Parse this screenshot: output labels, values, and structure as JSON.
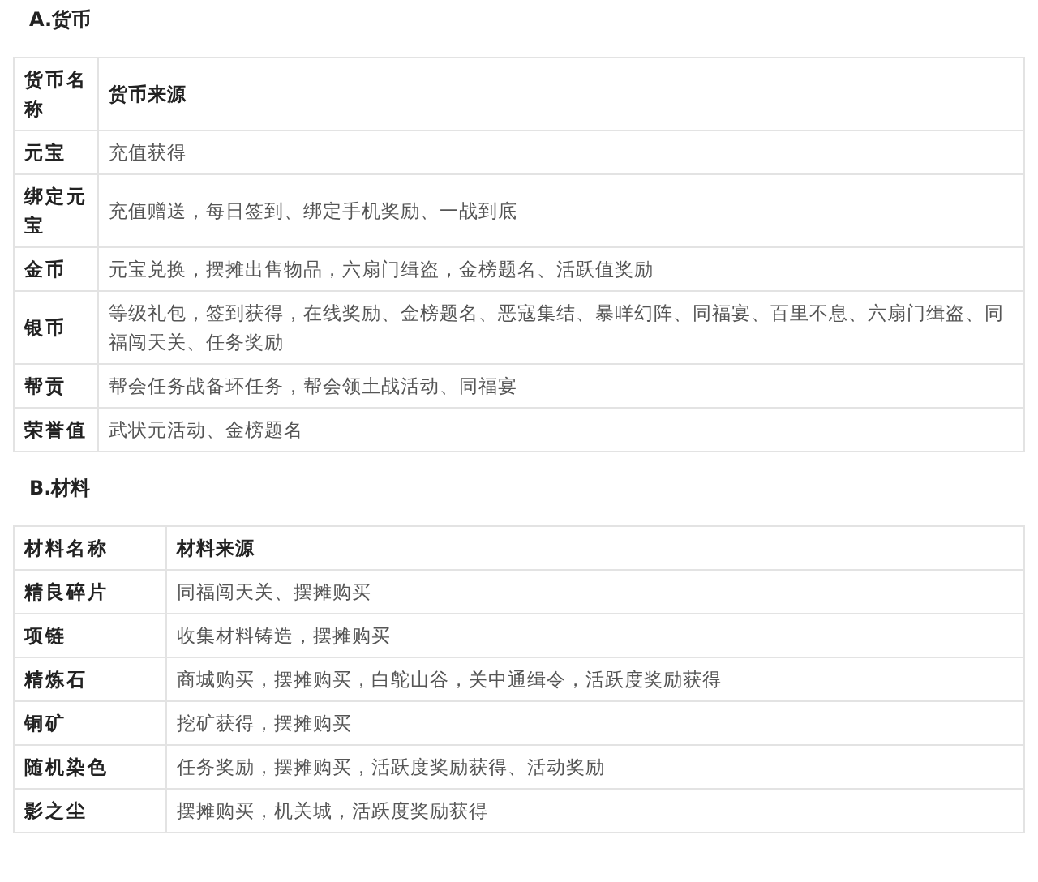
{
  "sections": [
    {
      "heading": "A.货币",
      "columns": [
        "货币名称",
        "货币来源"
      ],
      "rows": [
        [
          "元宝",
          "充值获得"
        ],
        [
          "绑定元宝",
          "充值赠送，每日签到、绑定手机奖励、一战到底"
        ],
        [
          "金币",
          "元宝兑换，摆摊出售物品，六扇门缉盗，金榜题名、活跃值奖励"
        ],
        [
          "银币",
          "等级礼包，签到获得，在线奖励、金榜题名、恶寇集结、暴咩幻阵、同福宴、百里不息、六扇门缉盗、同福闯天关、任务奖励"
        ],
        [
          "帮贡",
          "帮会任务战备环任务，帮会领土战活动、同福宴"
        ],
        [
          "荣誉值",
          "武状元活动、金榜题名"
        ]
      ]
    },
    {
      "heading": "B.材料",
      "columns": [
        "材料名称",
        "材料来源"
      ],
      "rows": [
        [
          "精良碎片",
          "同福闯天关、摆摊购买"
        ],
        [
          "项链",
          "收集材料铸造，摆摊购买"
        ],
        [
          "精炼石",
          "商城购买，摆摊购买，白鸵山谷，关中通缉令，活跃度奖励获得"
        ],
        [
          "铜矿",
          "挖矿获得，摆摊购买"
        ],
        [
          "随机染色",
          "任务奖励，摆摊购买，活跃度奖励获得、活动奖励"
        ],
        [
          "影之尘",
          "摆摊购买，机关城，活跃度奖励获得"
        ]
      ]
    }
  ]
}
